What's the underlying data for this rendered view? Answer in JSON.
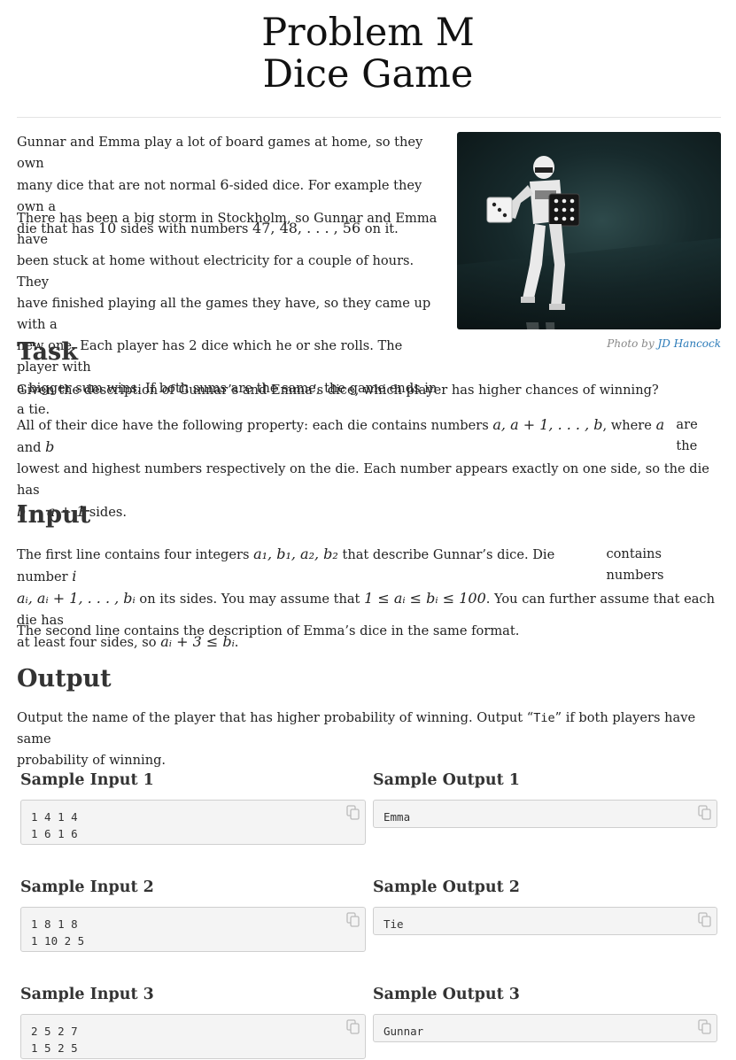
{
  "header": {
    "problem_line": "Problem M",
    "name_line": "Dice Game"
  },
  "intro": {
    "p1_a": "Gunnar and Emma play a lot of board games at home, so they own",
    "p1_b1": "many dice that are not normal ",
    "p1_b_num": "6",
    "p1_b2": "-sided dice. For example they own a",
    "p1_c1": "die that has ",
    "p1_c_num": "10",
    "p1_c2": " sides with numbers ",
    "p1_c_math": "47, 48, . . . , 56",
    "p1_c3": " on it.",
    "p2_lines": [
      "There has been a big storm in Stockholm, so Gunnar and Emma have",
      "been stuck at home without electricity for a couple of hours. They",
      "have finished playing all the games they have, so they came up with a",
      "new one. Each player has 2 dice which he or she rolls. The player with",
      "a bigger sum wins. If both sums are the same, the game ends in a tie."
    ]
  },
  "photo": {
    "credit_prefix": "Photo by ",
    "credit_author": "JD Hancock"
  },
  "task": {
    "heading": "Task",
    "p1": "Given the description of Gunnar’s and Emma’s dice, which player has higher chances of winning?",
    "p2_l1a": "All of their dice have the following property: each die contains numbers ",
    "p2_l1m": "a, a + 1, . . . , b",
    "p2_l1b": ", where ",
    "p2_l1a2": "a",
    "p2_l1c": " and ",
    "p2_l1b2": "b",
    "p2_l1d": " are the",
    "p2_l2": "lowest and highest numbers respectively on the die. Each number appears exactly on one side, so the die has",
    "p2_l3m": "b − a + 1",
    "p2_l3b": " sides."
  },
  "input": {
    "heading": "Input",
    "l1a": "The first line contains four integers ",
    "l1m": "a₁, b₁, a₂, b₂",
    "l1b": " that describe Gunnar’s dice. Die number ",
    "l1i": "i",
    "l1c": " contains numbers",
    "l2m": "aᵢ, aᵢ + 1, . . . , bᵢ",
    "l2b": " on its sides. You may assume that ",
    "l2m2": "1 ≤ aᵢ ≤ bᵢ ≤ 100",
    "l2c": ". You can further assume that each die has",
    "l3a": "at least four sides, so ",
    "l3m": "aᵢ + 3 ≤ bᵢ",
    "l3b": ".",
    "p2": "The second line contains the description of Emma’s dice in the same format."
  },
  "output": {
    "heading": "Output",
    "l1a": "Output the name of the player that has higher probability of winning. Output “",
    "l1code": "Tie",
    "l1b": "” if both players have same",
    "l2": "probability of winning."
  },
  "samples": [
    {
      "input_label": "Sample Input 1",
      "output_label": "Sample Output 1",
      "input": "1 4 1 4\n1 6 1 6",
      "output": "Emma"
    },
    {
      "input_label": "Sample Input 2",
      "output_label": "Sample Output 2",
      "input": "1 8 1 8\n1 10 2 5",
      "output": "Tie"
    },
    {
      "input_label": "Sample Input 3",
      "output_label": "Sample Output 3",
      "input": "2 5 2 7\n1 5 2 5",
      "output": "Gunnar"
    }
  ],
  "icons": {
    "copy": "copy-icon"
  }
}
